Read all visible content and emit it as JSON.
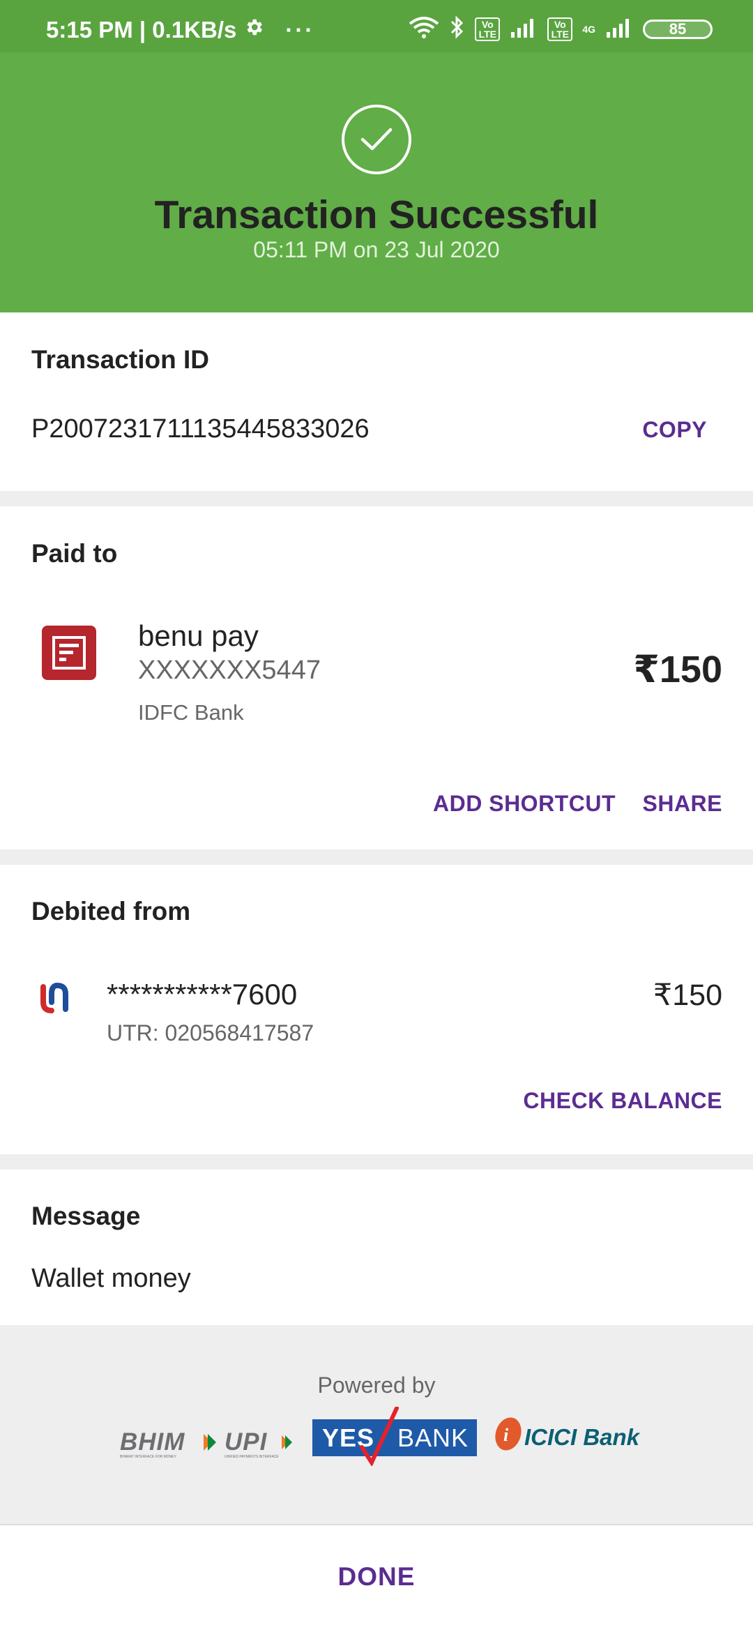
{
  "status_bar": {
    "time_speed": "5:15 PM | 0.1KB/s",
    "dots": "···",
    "volte1": "Vo LTE",
    "volte2": "Vo LTE",
    "net": "4G",
    "battery": "85"
  },
  "header": {
    "title": "Transaction Successful",
    "subtitle": "05:11 PM on 23 Jul 2020"
  },
  "transaction": {
    "label": "Transaction ID",
    "id": "P2007231711135445833026",
    "copy": "COPY"
  },
  "paid_to": {
    "label": "Paid to",
    "name": "benu pay",
    "account": "XXXXXXX5447",
    "bank": "IDFC Bank",
    "amount": "₹150",
    "add_shortcut": "ADD SHORTCUT",
    "share": "SHARE"
  },
  "debited_from": {
    "label": "Debited from",
    "account": "***********7600",
    "utr": "UTR: 020568417587",
    "amount": "₹150",
    "check_balance": "CHECK BALANCE"
  },
  "message": {
    "label": "Message",
    "text": "Wallet money"
  },
  "powered": {
    "label": "Powered by",
    "bhim": "BHIM",
    "upi": "UPI",
    "bhim_tag": "BHARAT INTERFACE FOR MONEY",
    "upi_tag": "UNIFIED PAYMENTS INTERFACE",
    "yes": "YES",
    "bank": "BANK",
    "icici": "ICICI Bank"
  },
  "footer": {
    "done": "DONE"
  },
  "colors": {
    "header_green": "#61ad47",
    "status_green": "#5aa440",
    "accent_purple": "#5b2c91",
    "merchant_red": "#b5262d",
    "yes_blue": "#1e5aa8",
    "icici_orange": "#e2592b",
    "icici_teal": "#0b5f73"
  },
  "icons": [
    "gear-icon",
    "wifi-icon",
    "bluetooth-icon",
    "signal-icon",
    "battery-icon",
    "check-icon",
    "merchant-logo-icon",
    "union-bank-icon"
  ]
}
